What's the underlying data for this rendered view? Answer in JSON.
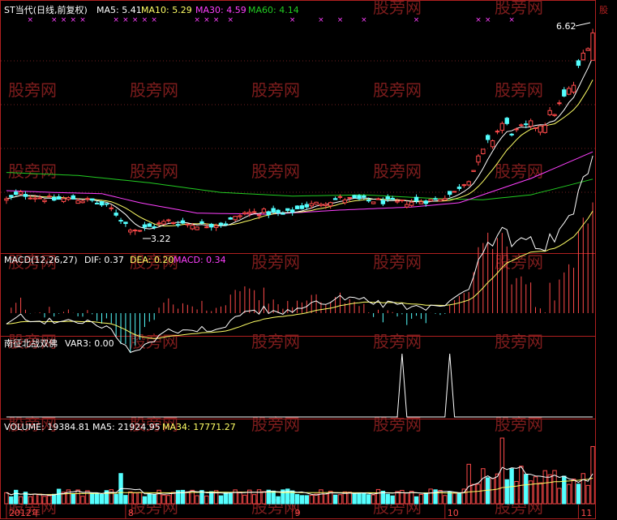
{
  "watermark": "股旁网",
  "colors": {
    "background": "#000000",
    "frame": "#b02020",
    "up": "#ff4a4a",
    "down": "#54ffff",
    "ma5": "#ffffff",
    "ma10": "#ffff66",
    "ma30": "#ff40ff",
    "ma60": "#22cc22",
    "dif": "#ffffff",
    "dea": "#ffff66",
    "macd": "#ff40ff",
    "label": "#ffffff",
    "watermark": "#8a2020"
  },
  "panels": {
    "price": {
      "title": "ST当代(日线,前复权)",
      "ma5_label": "MA5: 5.41",
      "ma10_label": "MA10: 5.29",
      "ma30_label": "MA30: 4.59",
      "ma60_label": "MA60: 4.14",
      "high_label": "6.62",
      "low_label": "3.22",
      "edge_glyph": "股"
    },
    "macd": {
      "name_label": "MACD(12,26,27)",
      "dif_label": "DIF: 0.37",
      "dea_label": "DEA: 0.20",
      "macd_label": "MACD: 0.34"
    },
    "indicator": {
      "name_label": "南征北战双佛",
      "var_label": "VAR3: 0.00"
    },
    "volume": {
      "vol_label": "VOLUME: 19384.81",
      "ma5_label": "MA5: 21924.95",
      "ma34_label": "MA34: 17771.27"
    }
  },
  "time_axis": {
    "labels": [
      {
        "text": "2012年",
        "index": 0
      },
      {
        "text": "8",
        "index": 25
      },
      {
        "text": "9",
        "index": 60
      },
      {
        "text": "10",
        "index": 92
      },
      {
        "text": "11",
        "index": 120
      }
    ]
  },
  "chart_data": [
    {
      "type": "candlestick",
      "title": "ST当代(日线,前复权)",
      "ylim": [
        3.0,
        6.8
      ],
      "annotations": {
        "high": 6.62,
        "low": 3.22
      },
      "ma_values_last": {
        "MA5": 5.41,
        "MA10": 5.29,
        "MA30": 4.59,
        "MA60": 4.14
      },
      "signal_marks": "x",
      "note": "ohlc and volume reconstructed by a seeded generator following the visible trend; series anchors in data units"
    },
    {
      "type": "line",
      "title": "MACD(12,26,27)",
      "series_last": {
        "DIF": 0.37,
        "DEA": 0.2,
        "MACD": 0.34
      }
    },
    {
      "type": "line",
      "title": "南征北战双佛",
      "series_last": {
        "VAR3": 0.0
      },
      "spikes_at_index": [
        83,
        93
      ]
    },
    {
      "type": "bar",
      "title": "VOLUME",
      "series_last": {
        "VOLUME": 19384.81,
        "MA5": 21924.95,
        "MA34": 17771.27
      }
    }
  ],
  "trend": {
    "anchors": [
      [
        0,
        3.8
      ],
      [
        3,
        3.9
      ],
      [
        6,
        3.85
      ],
      [
        10,
        3.8
      ],
      [
        14,
        3.82
      ],
      [
        18,
        3.78
      ],
      [
        22,
        3.65
      ],
      [
        25,
        3.4
      ],
      [
        27,
        3.28
      ],
      [
        30,
        3.35
      ],
      [
        34,
        3.45
      ],
      [
        38,
        3.4
      ],
      [
        42,
        3.38
      ],
      [
        46,
        3.42
      ],
      [
        50,
        3.58
      ],
      [
        54,
        3.6
      ],
      [
        58,
        3.55
      ],
      [
        62,
        3.68
      ],
      [
        66,
        3.75
      ],
      [
        70,
        3.82
      ],
      [
        74,
        3.8
      ],
      [
        78,
        3.78
      ],
      [
        82,
        3.75
      ],
      [
        86,
        3.77
      ],
      [
        90,
        3.8
      ],
      [
        94,
        3.92
      ],
      [
        98,
        4.3
      ],
      [
        101,
        4.7
      ],
      [
        104,
        5.05
      ],
      [
        107,
        4.9
      ],
      [
        110,
        5.0
      ],
      [
        113,
        5.1
      ],
      [
        116,
        5.35
      ],
      [
        119,
        5.7
      ],
      [
        121,
        6.2
      ],
      [
        123,
        6.6
      ]
    ],
    "count": 124,
    "spike_days": [
      83,
      93
    ],
    "ma30_anchor": [
      [
        0,
        3.95
      ],
      [
        10,
        3.92
      ],
      [
        20,
        3.9
      ],
      [
        28,
        3.75
      ],
      [
        40,
        3.58
      ],
      [
        55,
        3.56
      ],
      [
        70,
        3.63
      ],
      [
        85,
        3.68
      ],
      [
        95,
        3.75
      ],
      [
        110,
        4.15
      ],
      [
        123,
        4.59
      ]
    ],
    "ma60_anchor": [
      [
        0,
        4.25
      ],
      [
        15,
        4.2
      ],
      [
        30,
        4.08
      ],
      [
        45,
        3.92
      ],
      [
        60,
        3.86
      ],
      [
        75,
        3.88
      ],
      [
        90,
        3.82
      ],
      [
        100,
        3.8
      ],
      [
        110,
        3.88
      ],
      [
        123,
        4.14
      ]
    ]
  }
}
